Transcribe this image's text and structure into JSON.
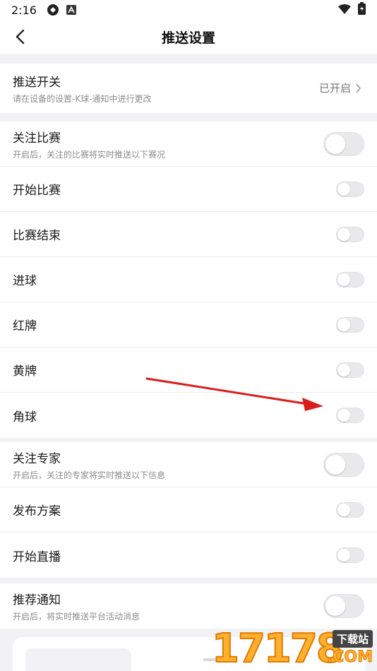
{
  "status_bar": {
    "time": "2:16"
  },
  "header": {
    "title": "推送设置"
  },
  "push_switch": {
    "label": "推送开关",
    "sub": "请在设备的设置-K球-通知中进行更改",
    "status": "已开启"
  },
  "match_section": {
    "follow": {
      "label": "关注比赛",
      "sub": "开启后，关注的比赛将实时推送以下赛况",
      "on": false
    },
    "items": [
      {
        "label": "开始比赛",
        "on": false
      },
      {
        "label": "比赛结束",
        "on": false
      },
      {
        "label": "进球",
        "on": false
      },
      {
        "label": "红牌",
        "on": false
      },
      {
        "label": "黄牌",
        "on": false
      },
      {
        "label": "角球",
        "on": false
      }
    ]
  },
  "expert_section": {
    "follow": {
      "label": "关注专家",
      "sub": "开启后，关注的专家将实时推送以下信息",
      "on": false
    },
    "items": [
      {
        "label": "发布方案",
        "on": false
      },
      {
        "label": "开始直播",
        "on": false
      }
    ]
  },
  "recommend_section": {
    "label": "推荐通知",
    "sub": "开启后，将实时推送平台活动消息",
    "on": false
  },
  "watermark": {
    "digits": "17178",
    "tag": "下载站",
    "com": ".COM"
  },
  "colors": {
    "toggle_off": "#e9e9ec",
    "arrow": "#d81e1e",
    "page_bg": "#f2f2f4"
  },
  "icons": [
    "settings-gear-icon",
    "a-badge-icon",
    "wifi-icon",
    "battery-icon",
    "back-arrow-icon",
    "chevron-right-icon"
  ]
}
